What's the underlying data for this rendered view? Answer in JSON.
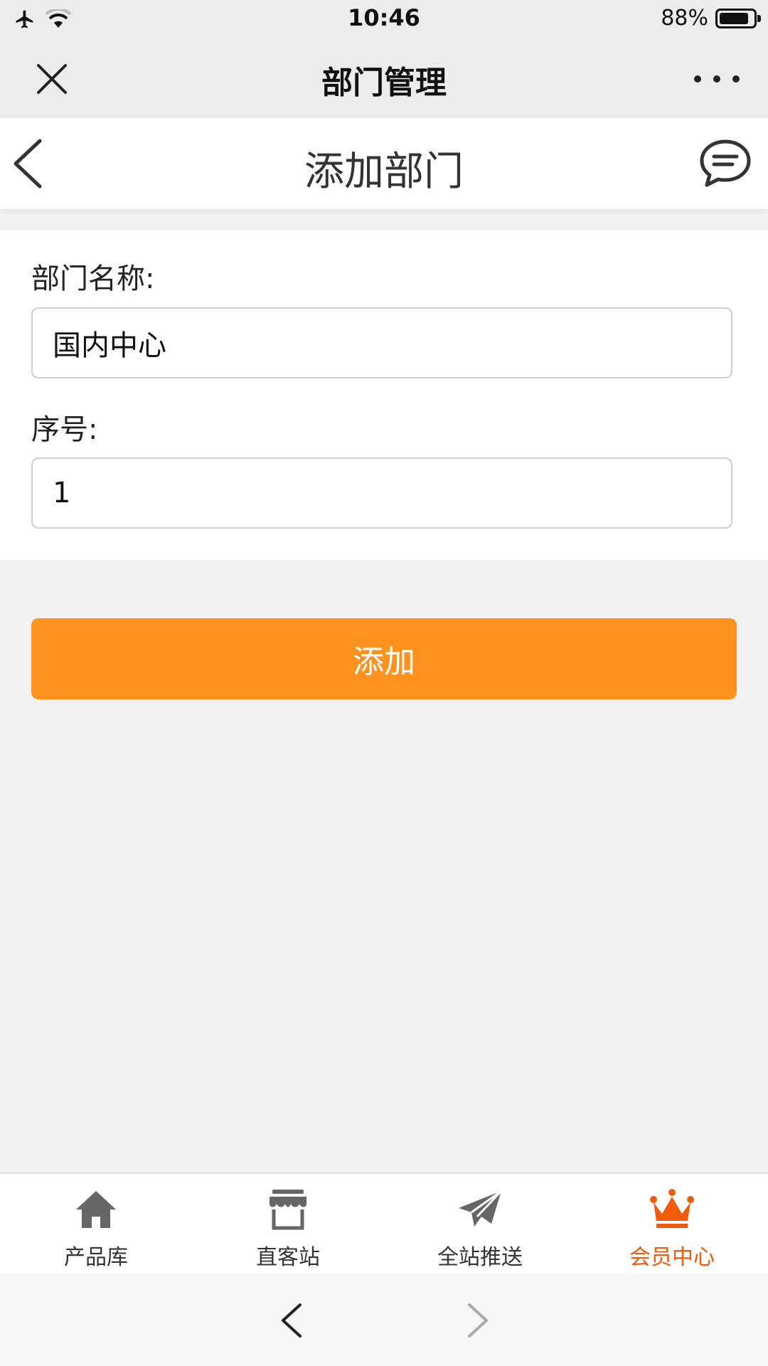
{
  "status_bar": {
    "time": "10:46",
    "battery_percent": "88%",
    "battery_level": 0.88
  },
  "title_bar": {
    "title": "部门管理"
  },
  "page_header": {
    "title": "添加部门"
  },
  "form": {
    "name_label": "部门名称:",
    "name_value": "国内中心",
    "order_label": "序号:",
    "order_value": "1",
    "submit_label": "添加"
  },
  "tabs": [
    {
      "label": "产品库",
      "icon": "home-icon",
      "active": false
    },
    {
      "label": "直客站",
      "icon": "store-icon",
      "active": false
    },
    {
      "label": "全站推送",
      "icon": "paper-plane-icon",
      "active": false
    },
    {
      "label": "会员中心",
      "icon": "crown-icon",
      "active": true
    }
  ],
  "colors": {
    "accent_button": "#fd921f",
    "active_tab": "#f35b0c",
    "icon_gray": "#666666"
  }
}
